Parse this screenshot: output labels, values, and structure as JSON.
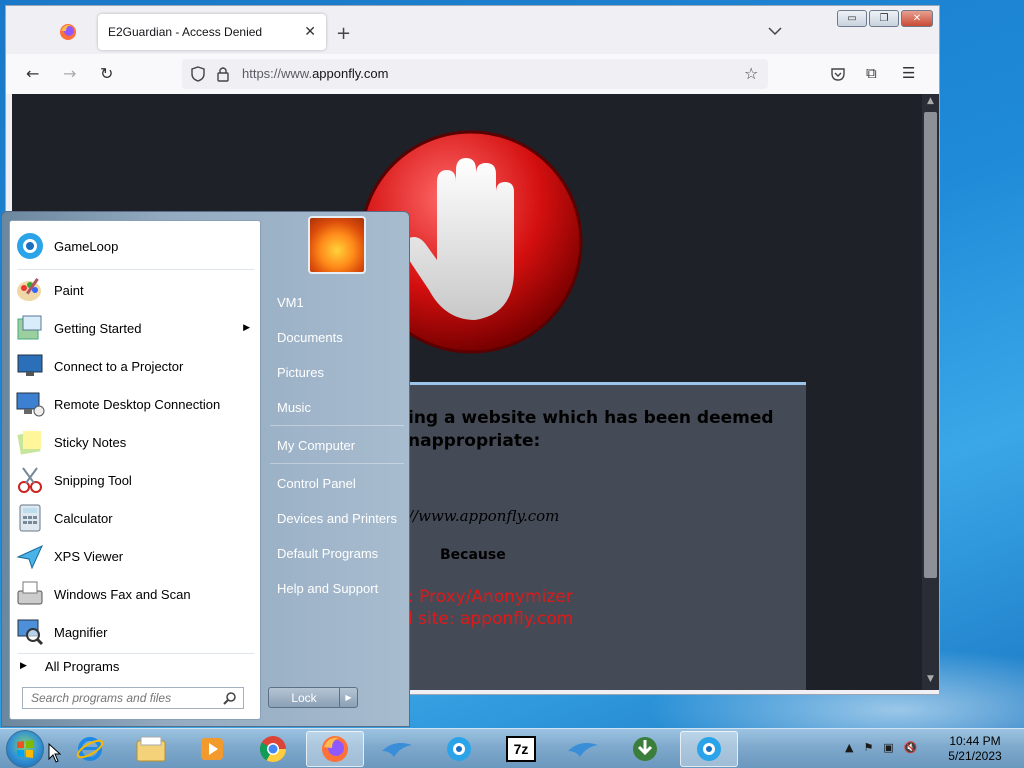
{
  "browser": {
    "tab_title": "E2Guardian - Access Denied",
    "url_prefix": "https://www.",
    "url_domain": "apponfly.com"
  },
  "blockpage": {
    "heading_line1": "ing a website which has been deemed",
    "heading_line2": "nappropriate:",
    "url": "//www.apponfly.com",
    "because": "Because",
    "reason": ": Proxy/Anonymizer",
    "site": "l site: apponfly.com",
    "accent_color": "#e01818"
  },
  "startmenu": {
    "programs": [
      {
        "label": "GameLoop",
        "icon": "gameloop-icon"
      },
      {
        "label": "Paint",
        "icon": "paint-icon"
      },
      {
        "label": "Getting Started",
        "icon": "getting-started-icon"
      },
      {
        "label": "Connect to a Projector",
        "icon": "projector-icon"
      },
      {
        "label": "Remote Desktop Connection",
        "icon": "remote-desktop-icon"
      },
      {
        "label": "Sticky Notes",
        "icon": "sticky-notes-icon"
      },
      {
        "label": "Snipping Tool",
        "icon": "snipping-tool-icon"
      },
      {
        "label": "Calculator",
        "icon": "calculator-icon"
      },
      {
        "label": "XPS Viewer",
        "icon": "xps-viewer-icon"
      },
      {
        "label": "Windows Fax and Scan",
        "icon": "fax-scan-icon"
      },
      {
        "label": "Magnifier",
        "icon": "magnifier-icon"
      }
    ],
    "all_programs": "All Programs",
    "search_placeholder": "Search programs and files",
    "right_items": [
      "VM1",
      "Documents",
      "Pictures",
      "Music",
      "My Computer",
      "Control Panel",
      "Devices and Printers",
      "Default Programs",
      "Help and Support"
    ],
    "lock_label": "Lock"
  },
  "taskbar": {
    "apps": [
      "ie-icon",
      "explorer-icon",
      "media-player-icon",
      "chrome-icon",
      "firefox-icon",
      "app-dolphin-icon",
      "gameloop-icon",
      "7zip-icon",
      "app-dolphin-icon",
      "download-manager-icon",
      "gameloop-icon"
    ],
    "time": "10:44 PM",
    "date": "5/21/2023",
    "zip_label": "7z"
  }
}
